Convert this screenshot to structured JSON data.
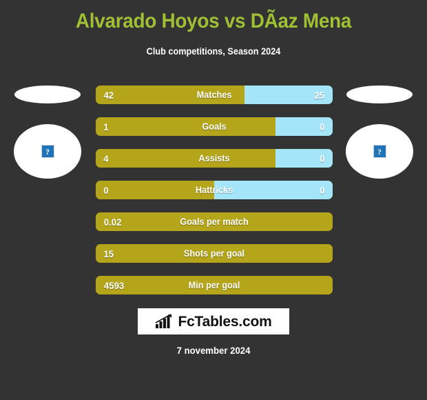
{
  "header": {
    "title": "Alvarado Hoyos vs DÃ­az Mena",
    "subtitle": "Club competitions, Season 2024"
  },
  "players": {
    "home": {
      "flag_icon": "flag-placeholder-icon",
      "avatar_icon": "broken-image-icon",
      "avatar_glyph": "?"
    },
    "away": {
      "flag_icon": "flag-placeholder-icon",
      "avatar_icon": "broken-image-icon",
      "avatar_glyph": "?"
    }
  },
  "colors": {
    "background": "#333333",
    "title": "#9fc034",
    "home_bar": "#b4a51a",
    "away_bar": "#a5e5fa",
    "text": "#ffffff"
  },
  "chart_data": {
    "type": "bar",
    "title": "Alvarado Hoyos vs DÃ­az Mena",
    "subtitle": "Club competitions, Season 2024",
    "orientation": "horizontal-diverging",
    "series": [
      {
        "name": "Alvarado Hoyos",
        "color": "#b4a51a",
        "side": "left"
      },
      {
        "name": "DÃ­az Mena",
        "color": "#a5e5fa",
        "side": "right"
      }
    ],
    "categories": [
      "Matches",
      "Goals",
      "Assists",
      "Hattricks",
      "Goals per match",
      "Shots per goal",
      "Min per goal"
    ],
    "rows": [
      {
        "label": "Matches",
        "home": "42",
        "away": "25",
        "home_pct": 62.7,
        "two_sided": true
      },
      {
        "label": "Goals",
        "home": "1",
        "away": "0",
        "home_pct": 76.0,
        "two_sided": true
      },
      {
        "label": "Assists",
        "home": "4",
        "away": "0",
        "home_pct": 76.0,
        "two_sided": true
      },
      {
        "label": "Hattricks",
        "home": "0",
        "away": "0",
        "home_pct": 50.0,
        "two_sided": true
      },
      {
        "label": "Goals per match",
        "home": "0.02",
        "away": "",
        "home_pct": 100,
        "two_sided": false
      },
      {
        "label": "Shots per goal",
        "home": "15",
        "away": "",
        "home_pct": 100,
        "two_sided": false
      },
      {
        "label": "Min per goal",
        "home": "4593",
        "away": "",
        "home_pct": 100,
        "two_sided": false
      }
    ]
  },
  "footer": {
    "logo_text": "FcTables.com",
    "logo_icon": "bar-chart-icon",
    "date": "7 november 2024"
  }
}
